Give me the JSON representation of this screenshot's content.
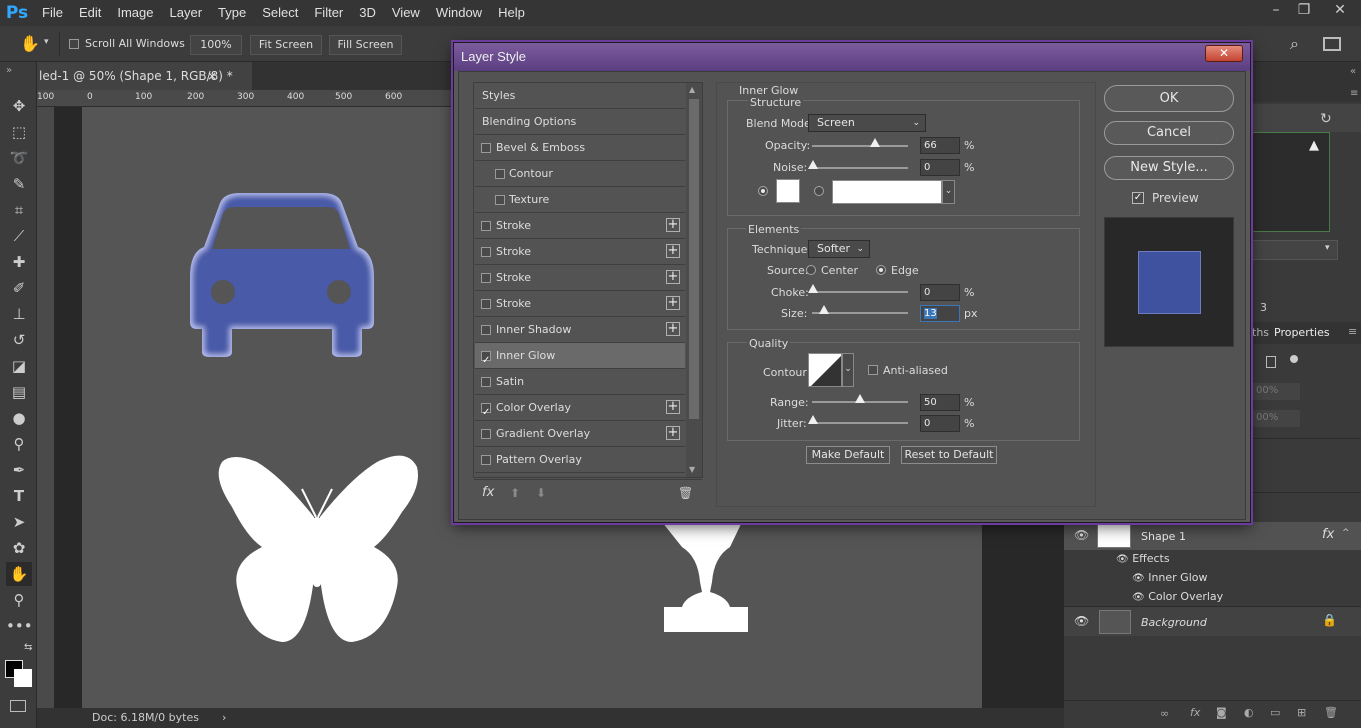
{
  "menubar": {
    "logo": "Ps",
    "items": [
      "File",
      "Edit",
      "Image",
      "Layer",
      "Type",
      "Select",
      "Filter",
      "3D",
      "View",
      "Window",
      "Help"
    ]
  },
  "options": {
    "scroll_all_windows": "Scroll All Windows",
    "zoom": "100%",
    "fit_screen": "Fit Screen",
    "fill_screen": "Fill Screen"
  },
  "document": {
    "tab_title": "led-1 @ 50% (Shape 1, RGB/8) *",
    "ruler_labels": [
      "100",
      "0",
      "100",
      "200",
      "300",
      "400",
      "500",
      "600"
    ],
    "status": "Doc: 6.18M/0 bytes"
  },
  "right_panel": {
    "tabs_partial": "ths",
    "properties_tab": "Properties",
    "pct1": "00%",
    "pct2": "00%",
    "digit": "3",
    "layers": {
      "shape_layer": "Shape 1",
      "effects_label": "Effects",
      "effect1": "Inner Glow",
      "effect2": "Color Overlay",
      "background_layer": "Background"
    }
  },
  "dialog": {
    "title": "Layer Style",
    "styles_header": "Styles",
    "blending_options": "Blending Options",
    "style_items": [
      {
        "label": "Bevel & Emboss",
        "checked": false,
        "plus": false,
        "indent": false
      },
      {
        "label": "Contour",
        "checked": false,
        "plus": false,
        "indent": true
      },
      {
        "label": "Texture",
        "checked": false,
        "plus": false,
        "indent": true
      },
      {
        "label": "Stroke",
        "checked": false,
        "plus": true,
        "indent": false
      },
      {
        "label": "Stroke",
        "checked": false,
        "plus": true,
        "indent": false
      },
      {
        "label": "Stroke",
        "checked": false,
        "plus": true,
        "indent": false
      },
      {
        "label": "Stroke",
        "checked": false,
        "plus": true,
        "indent": false
      },
      {
        "label": "Inner Shadow",
        "checked": false,
        "plus": true,
        "indent": false
      },
      {
        "label": "Inner Glow",
        "checked": true,
        "plus": false,
        "indent": false,
        "selected": true
      },
      {
        "label": "Satin",
        "checked": false,
        "plus": false,
        "indent": false
      },
      {
        "label": "Color Overlay",
        "checked": true,
        "plus": true,
        "indent": false
      },
      {
        "label": "Gradient Overlay",
        "checked": false,
        "plus": true,
        "indent": false
      },
      {
        "label": "Pattern Overlay",
        "checked": false,
        "plus": false,
        "indent": false
      }
    ],
    "fx_label": "fx",
    "panel_title": "Inner Glow",
    "structure": {
      "title": "Structure",
      "blend_mode_label": "Blend Mode:",
      "blend_mode_value": "Screen",
      "opacity_label": "Opacity:",
      "opacity_value": "66",
      "noise_label": "Noise:",
      "noise_value": "0",
      "pct": "%"
    },
    "elements": {
      "title": "Elements",
      "technique_label": "Technique:",
      "technique_value": "Softer",
      "source_label": "Source:",
      "center_label": "Center",
      "edge_label": "Edge",
      "choke_label": "Choke:",
      "choke_value": "0",
      "size_label": "Size:",
      "size_value": "13",
      "px": "px",
      "pct": "%"
    },
    "quality": {
      "title": "Quality",
      "contour_label": "Contour:",
      "anti_aliased": "Anti-aliased",
      "range_label": "Range:",
      "range_value": "50",
      "jitter_label": "Jitter:",
      "jitter_value": "0",
      "pct": "%"
    },
    "make_default": "Make Default",
    "reset_default": "Reset to Default",
    "ok": "OK",
    "cancel": "Cancel",
    "new_style": "New Style...",
    "preview": "Preview"
  },
  "colors": {
    "accent_glow": "#4a5aa8",
    "preview_swatch": "#3f52a0",
    "title_purple": "#6c4a92"
  }
}
